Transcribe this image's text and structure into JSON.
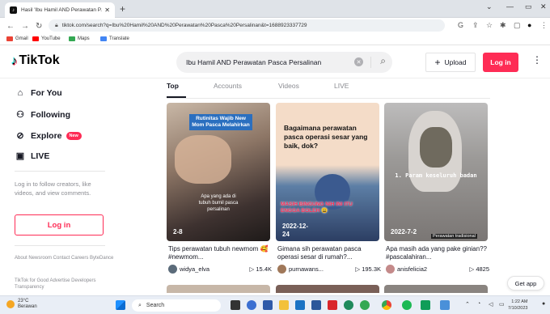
{
  "browser": {
    "tab_title": "Hasil 'Ibu Hamil AND Perawatan P...'",
    "url": "tiktok.com/search?q=Ibu%20Hamil%20AND%20Perawatan%20Pasca%20Persalinan&t=1688923337729",
    "bookmarks": [
      "Gmail",
      "YouTube",
      "Maps",
      "Translate"
    ]
  },
  "header": {
    "logo": "TikTok",
    "search_value": "Ibu Hamil AND Perawatan Pasca Persalinan",
    "upload_label": "Upload",
    "login_label": "Log in"
  },
  "sidebar": {
    "nav": [
      {
        "label": "For You",
        "icon": "home-icon"
      },
      {
        "label": "Following",
        "icon": "following-icon"
      },
      {
        "label": "Explore",
        "icon": "compass-icon",
        "badge": "New"
      },
      {
        "label": "LIVE",
        "icon": "live-icon"
      }
    ],
    "login_prompt": "Log in to follow creators, like videos, and view comments.",
    "login_button": "Log in",
    "footer1": "About  Newsroom  Contact  Careers  ByteDance",
    "footer2": "TikTok for Good  Advertise  Developers  Transparency"
  },
  "tabs": [
    "Top",
    "Accounts",
    "Videos",
    "LIVE"
  ],
  "videos": [
    {
      "overlay_top": "Rutinitas Wajib New Mom Pasca Melahirkan",
      "overlay_mid": "Apa yang ada di tubuh bumil pasca persalinan",
      "date": "2-8",
      "caption": "Tips perawatan tubuh newmom 🥰 #newmom...",
      "user": "widya_elva",
      "views": "15.4K"
    },
    {
      "overlay_top": "Bagaimana perawatan pasca operasi sesar yang baik, dok?",
      "overlay_mid": "MASIH BINGUNG NIH INI ITU ENGGA BOLEH 😩",
      "date": "2022-12-24",
      "caption": "Gimana sih perawatan pasca operasi sesar di rumah?...",
      "user": "purnawans...",
      "views": "195.3K"
    },
    {
      "overlay_top": "1. Param keseluruh badan",
      "overlay_mid": "Perawatan tradisional",
      "date": "2022-7-2",
      "caption": "Apa masih ada yang pake ginian??#pascalahiran...",
      "user": "anisfelicia2",
      "views": "4825"
    }
  ],
  "get_app": "Get app",
  "taskbar": {
    "weather_temp": "23°C",
    "weather_desc": "Berawan",
    "search_placeholder": "Search",
    "time": "1:22 AM",
    "date": "7/10/2023"
  }
}
